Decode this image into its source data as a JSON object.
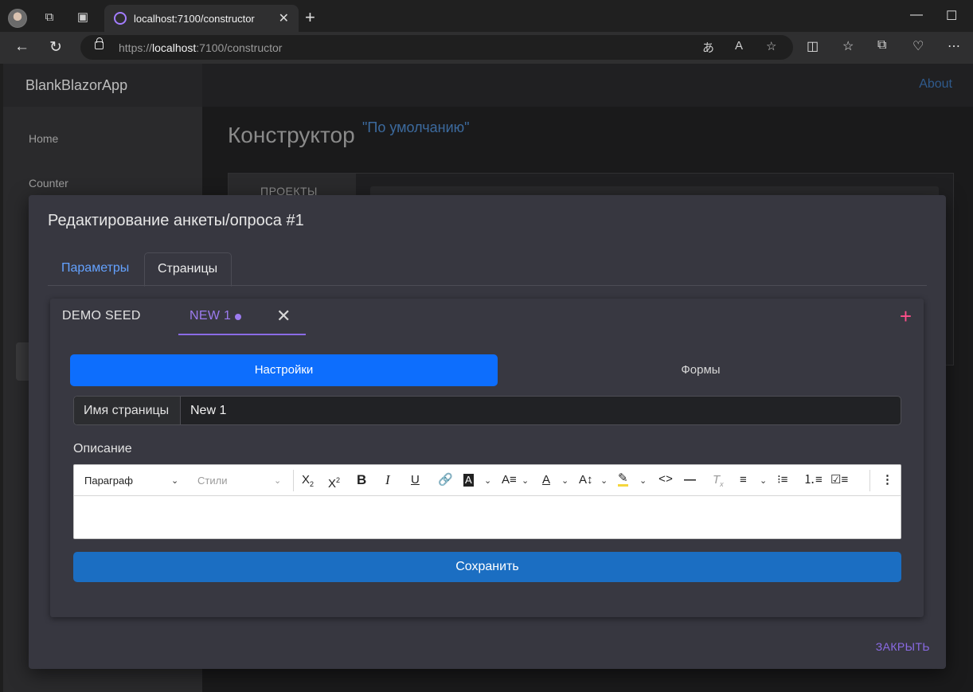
{
  "browser": {
    "tab_title": "localhost:7100/constructor",
    "url_prefix": "https://",
    "url_host": "localhost",
    "url_rest": ":7100/constructor",
    "new_tab": "+",
    "close_tab": "✕"
  },
  "app": {
    "brand": "BlankBlazorApp",
    "nav": [
      {
        "label": "Home"
      },
      {
        "label": "Counter"
      }
    ],
    "about": "About",
    "page_title": "Конструктор",
    "page_subtitle": "\"По умолчанию\"",
    "projects_tab": "ПРОЕКТЫ"
  },
  "dialog": {
    "title": "Редактирование анкеты/опроса #1",
    "tabs": [
      {
        "label": "Параметры",
        "active": false
      },
      {
        "label": "Страницы",
        "active": true
      }
    ],
    "page_tabs": [
      {
        "label": "DEMO SEED",
        "active": false
      },
      {
        "label": "NEW 1",
        "active": true
      }
    ],
    "segments": [
      {
        "label": "Настройки",
        "active": true
      },
      {
        "label": "Формы",
        "active": false
      }
    ],
    "page_name_label": "Имя страницы",
    "page_name_value": "New 1",
    "description_label": "Описание",
    "editor": {
      "paragraph_select": "Параграф",
      "styles_select": "Стили",
      "tools": [
        "subscript",
        "superscript",
        "bold",
        "italic",
        "underline",
        "link",
        "highlight-block",
        "font-family",
        "font-color",
        "font-size",
        "highlighter",
        "code",
        "horizontal-rule",
        "clear-format",
        "align",
        "bullet-list",
        "numbered-list",
        "todo-list",
        "more"
      ]
    },
    "save_button": "Сохранить",
    "close_button": "ЗАКРЫТЬ"
  },
  "colors": {
    "accent_purple": "#8b6be6",
    "primary_blue": "#0d6efd",
    "save_blue": "#1b6ec2",
    "add_pink": "#ff4f8b"
  }
}
